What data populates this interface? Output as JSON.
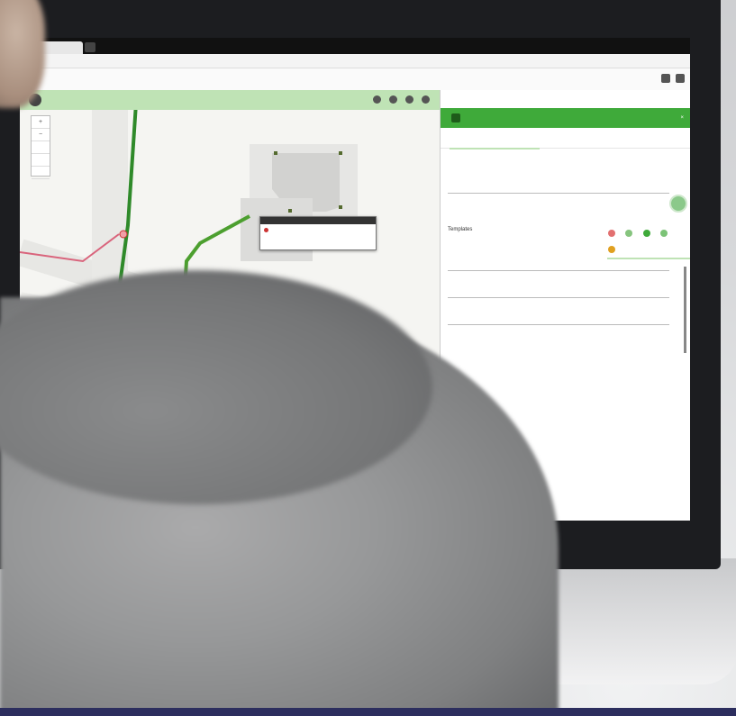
{
  "browser": {
    "tab_label": "",
    "address": ""
  },
  "app": {
    "tabs": [
      "",
      ""
    ],
    "map_title": "",
    "zoom_controls": [
      "+",
      "−",
      "",
      "",
      ""
    ],
    "popup_text": ""
  },
  "panel": {
    "title": "",
    "tabs": [
      "",
      ""
    ],
    "fields": [
      {
        "label": "",
        "value": ""
      },
      {
        "label": "Templates",
        "value": ""
      },
      {
        "label": "",
        "value": ""
      },
      {
        "label": "",
        "value": ""
      },
      {
        "label": "",
        "value": ""
      }
    ],
    "subtabs": [
      "",
      "",
      ""
    ],
    "checkbox_label": ""
  },
  "colors": {
    "accent_green": "#3faa3a",
    "light_green": "#bfe3b5",
    "route_green": "#2f8a2a",
    "route_pink": "#d9647c",
    "route_blue": "#5a7bd6",
    "wall_bottom_band": "#2c2e5e"
  },
  "icons": {
    "app_logo": "logo-icon",
    "add_record": "green-plus-icon",
    "fab": "locate-icon"
  }
}
